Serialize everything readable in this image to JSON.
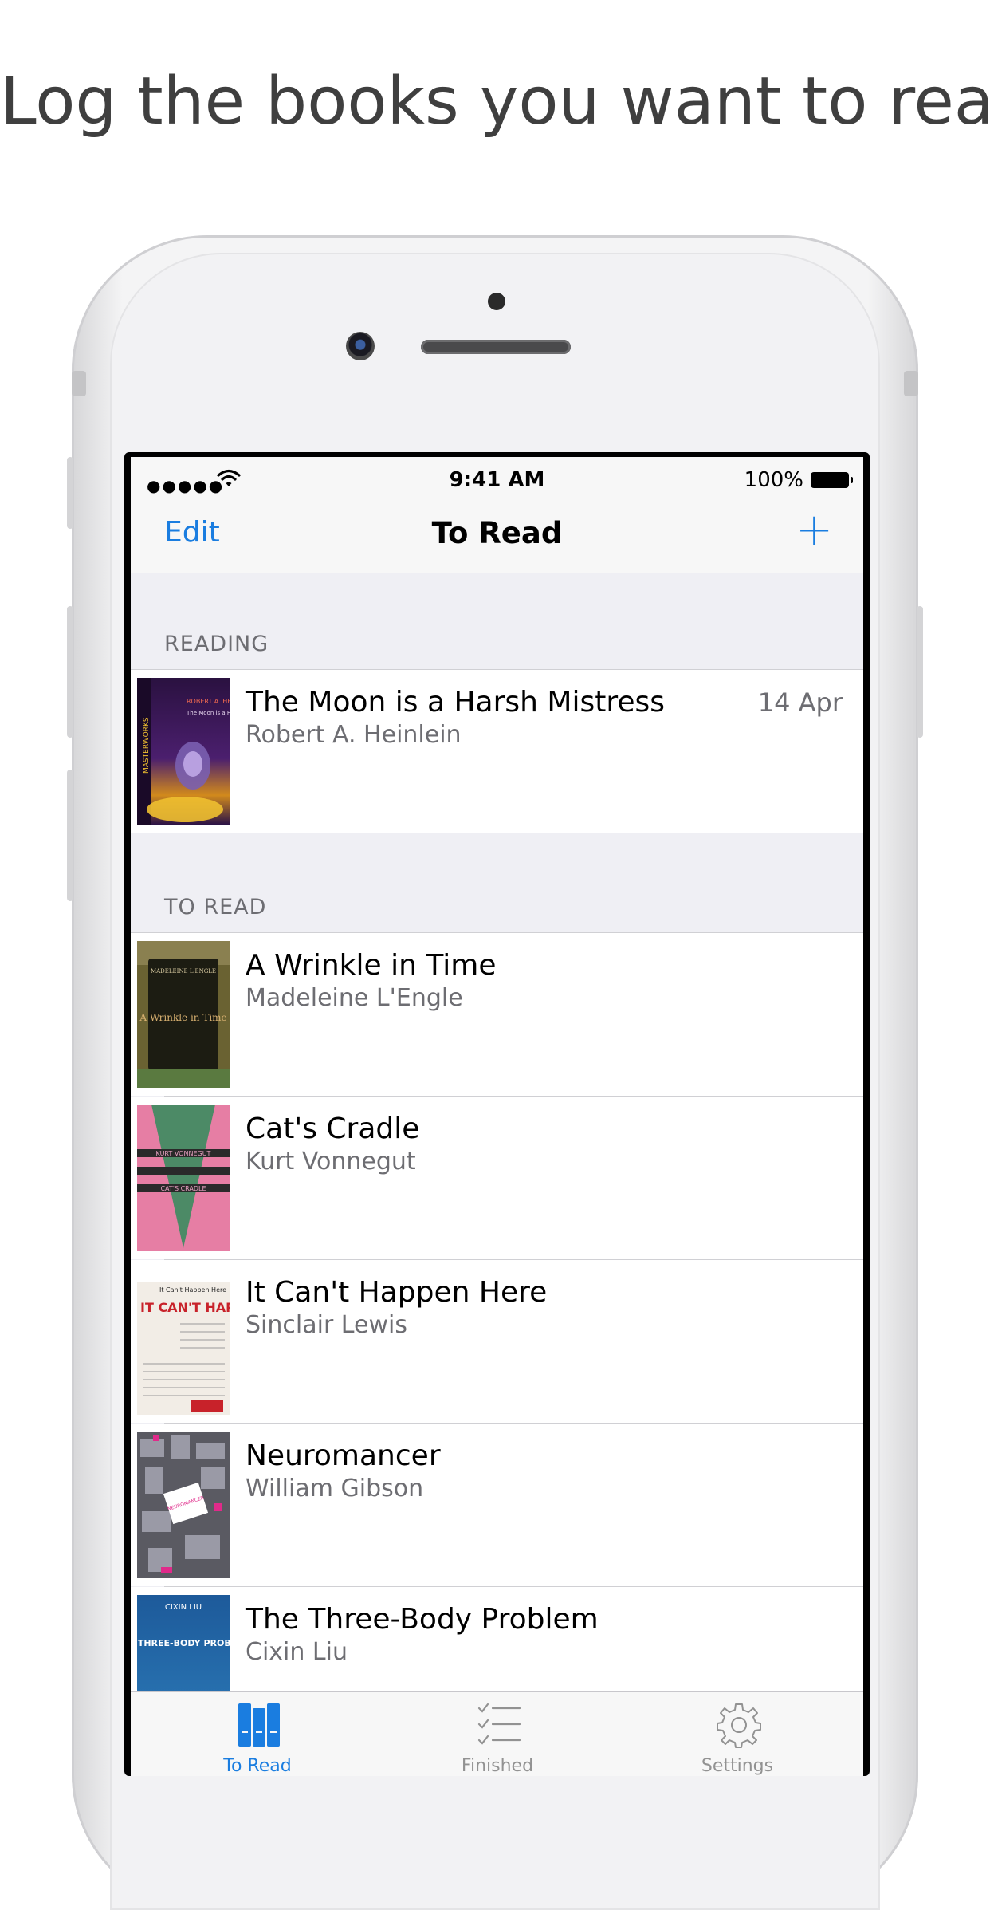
{
  "headline": "Log the books you want to read",
  "status_bar": {
    "signal": "●●●●●",
    "time": "9:41 AM",
    "battery": "100%"
  },
  "nav": {
    "edit": "Edit",
    "title": "To Read",
    "add": "+"
  },
  "sections": {
    "reading": "READING",
    "to_read": "TO READ"
  },
  "reading_books": [
    {
      "title": "The Moon is a Harsh Mistress",
      "author": "Robert A. Heinlein",
      "date": "14 Apr"
    }
  ],
  "to_read_books": [
    {
      "title": "A Wrinkle in Time",
      "author": "Madeleine L'Engle"
    },
    {
      "title": "Cat's Cradle",
      "author": "Kurt Vonnegut"
    },
    {
      "title": "It Can't Happen Here",
      "author": "Sinclair Lewis"
    },
    {
      "title": "Neuromancer",
      "author": "William Gibson"
    },
    {
      "title": "The Three-Body Problem",
      "author": "Cixin Liu"
    }
  ],
  "covers": {
    "moon": {
      "author": "ROBERT A. HEINLEIN",
      "title": "The Moon is a Harsh Mistress",
      "series": "MASTERWORKS"
    },
    "wrinkle": {
      "author": "MADELEINE L'ENGLE",
      "title": "A Wrinkle in Time"
    },
    "cradle": {
      "author": "KURT VONNEGUT",
      "title": "CAT'S CRADLE"
    },
    "happen": {
      "title": "IT CAN'T HAPPEN HERE",
      "subtitle": "It Can't Happen Here"
    },
    "neuro": {
      "title": "NEUROMANCER"
    },
    "threebody": {
      "author": "CIXIN LIU",
      "title": "THE THREE-BODY PROBLEM"
    }
  },
  "tabs": [
    {
      "label": "To Read",
      "active": true
    },
    {
      "label": "Finished",
      "active": false
    },
    {
      "label": "Settings",
      "active": false
    }
  ],
  "colors": {
    "accent": "#1a7de0",
    "inactive": "#929292"
  }
}
